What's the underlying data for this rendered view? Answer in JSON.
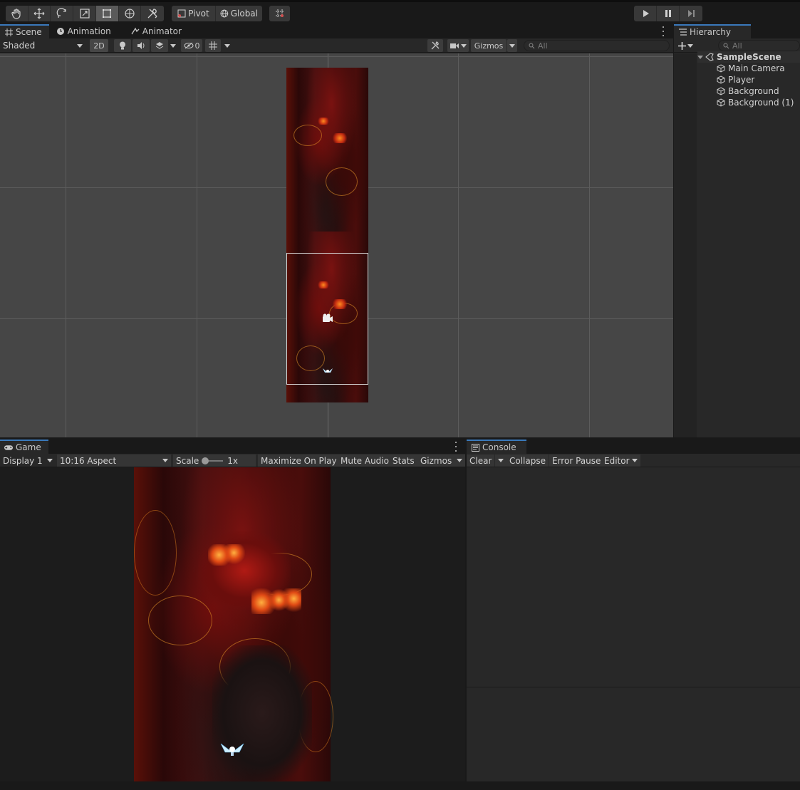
{
  "toolbar": {
    "tools": [
      "hand-icon",
      "move-icon",
      "rotate-icon",
      "scale-icon",
      "rect-transform-icon",
      "transform-icon",
      "custom-tool-icon"
    ],
    "pivot_label": "Pivot",
    "global_label": "Global"
  },
  "scene": {
    "tabs": [
      "Scene",
      "Animation",
      "Animator"
    ],
    "shading_mode": "Shaded",
    "mode_2d": "2D",
    "hidden_count": "0",
    "gizmos_label": "Gizmos",
    "search_placeholder": "All"
  },
  "hierarchy": {
    "tab_label": "Hierarchy",
    "search_placeholder": "All",
    "scene_name": "SampleScene",
    "objects": [
      "Main Camera",
      "Player",
      "Background",
      "Background (1)"
    ]
  },
  "game": {
    "tab_label": "Game",
    "display": "Display 1",
    "aspect": "10:16 Aspect",
    "scale_label": "Scale",
    "scale_value": "1x",
    "maximize_label": "Maximize On Play",
    "mute_label": "Mute Audio",
    "stats_label": "Stats",
    "gizmos_label": "Gizmos"
  },
  "console": {
    "tab_label": "Console",
    "clear_label": "Clear",
    "collapse_label": "Collapse",
    "error_pause_label": "Error Pause",
    "editor_label": "Editor"
  },
  "colors": {
    "accent": "#3a79bb",
    "panel": "#282828",
    "background": "#191919"
  }
}
